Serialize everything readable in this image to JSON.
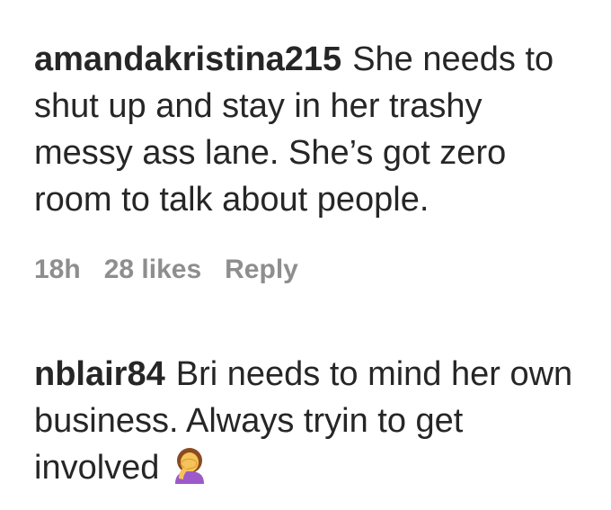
{
  "comments": [
    {
      "username": "amandakristina215",
      "text": "She needs to shut up and stay in her trashy messy ass lane. She’s got zero room to talk about people.",
      "time": "18h",
      "likes": "28 likes",
      "reply_label": "Reply"
    },
    {
      "username": "nblair84",
      "text": "Bri needs to mind her own business. Always tryin to get involved",
      "emoji": "woman-facepalming-icon"
    }
  ],
  "colors": {
    "text": "#262626",
    "meta": "#8e8e8e"
  }
}
